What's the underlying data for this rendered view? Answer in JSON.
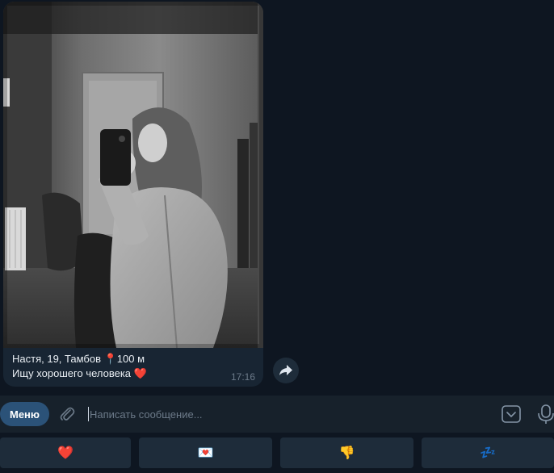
{
  "message": {
    "caption_line1": "Настя, 19, Тамбов 📍100 м",
    "caption_line2_text": "Ищу хорошего человека ",
    "caption_line2_emoji": "❤️",
    "time": "17:16"
  },
  "input_bar": {
    "menu_label": "Меню",
    "placeholder": "Написать сообщение..."
  },
  "reply_keyboard": {
    "buttons": [
      "❤️",
      "💌",
      "👎",
      "💤"
    ]
  },
  "colors": {
    "background": "#0e1621",
    "bubble": "#182533",
    "menu_button": "#2b5278",
    "keyboard_button": "#1e2c3a"
  },
  "icons": {
    "share": "share-arrow-icon",
    "attach": "paperclip-icon",
    "keyboard": "keyboard-toggle-icon",
    "mic": "microphone-icon"
  }
}
